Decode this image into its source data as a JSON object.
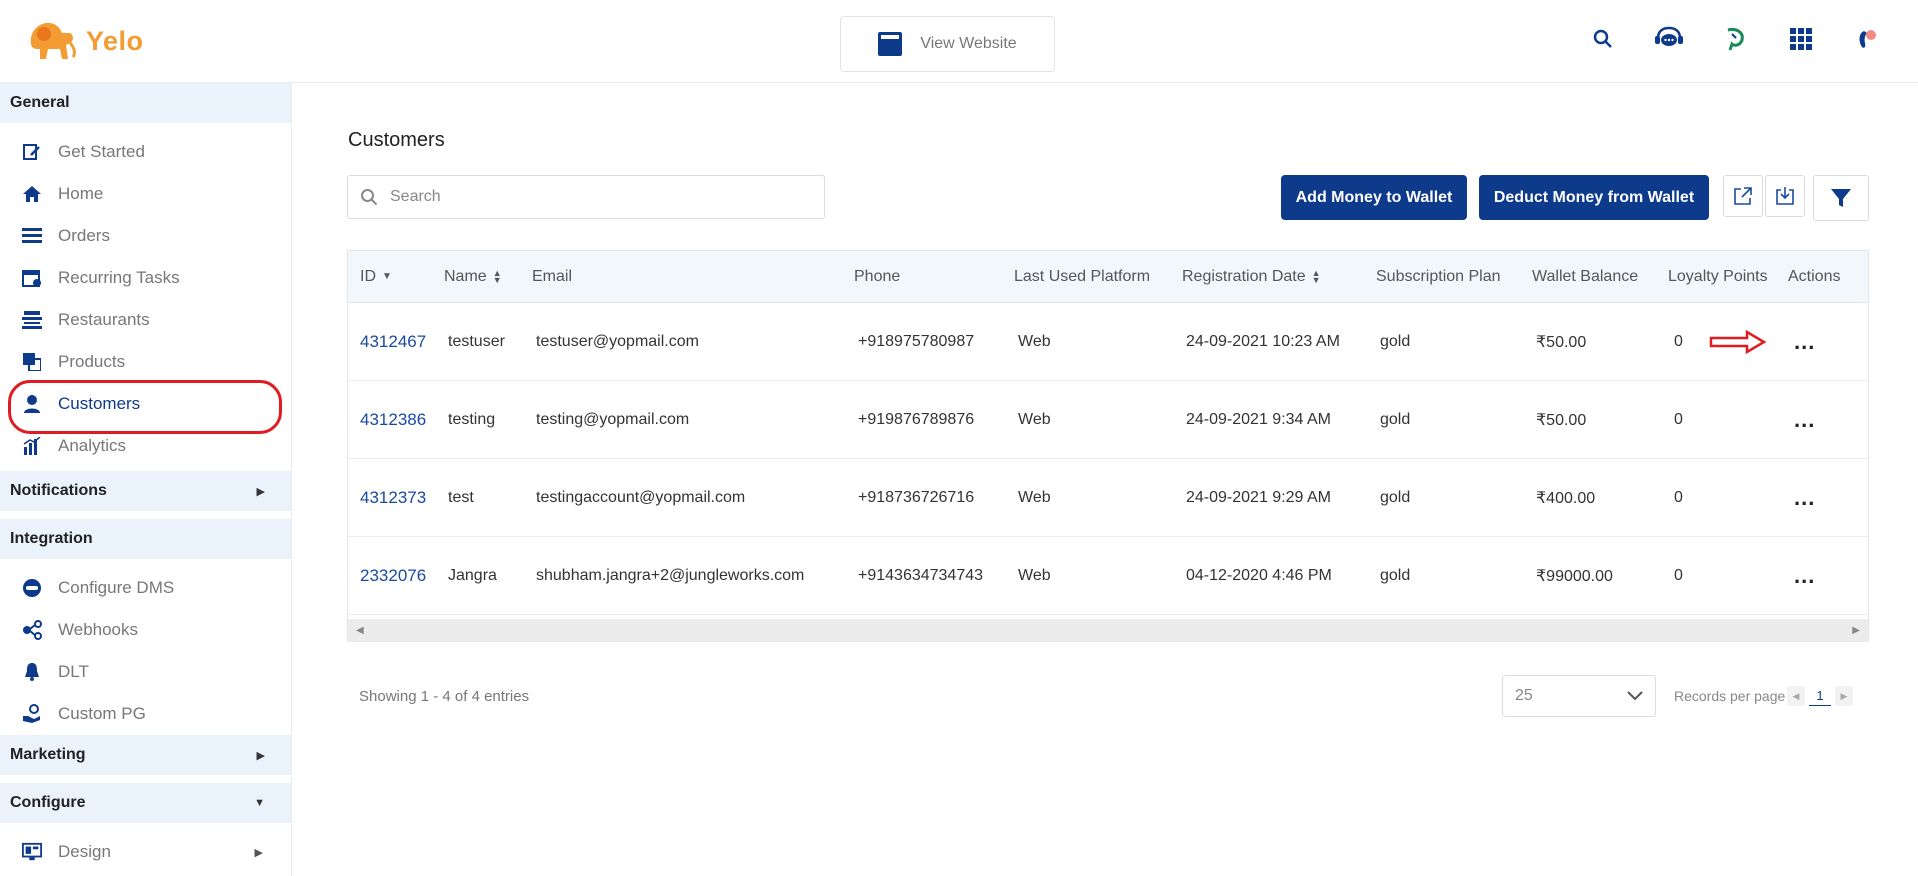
{
  "brand": {
    "name": "Yelo",
    "color": "#f39c34"
  },
  "header": {
    "view_website_label": "View Website",
    "icons": [
      "search-icon",
      "support-chat-icon",
      "leaf-icon",
      "apps-grid-icon",
      "profile-icon"
    ]
  },
  "sidebar": {
    "sections": {
      "general": "General",
      "notifications": "Notifications",
      "integration": "Integration",
      "marketing": "Marketing",
      "configure": "Configure"
    },
    "general_items": [
      {
        "label": "Get Started",
        "icon": "edit-icon"
      },
      {
        "label": "Home",
        "icon": "home-icon"
      },
      {
        "label": "Orders",
        "icon": "orders-icon"
      },
      {
        "label": "Recurring Tasks",
        "icon": "calendar-icon"
      },
      {
        "label": "Restaurants",
        "icon": "store-icon"
      },
      {
        "label": "Products",
        "icon": "products-icon"
      },
      {
        "label": "Customers",
        "icon": "customer-icon"
      },
      {
        "label": "Analytics",
        "icon": "analytics-icon"
      }
    ],
    "integration_items": [
      {
        "label": "Configure DMS",
        "icon": "dms-icon"
      },
      {
        "label": "Webhooks",
        "icon": "webhooks-icon"
      },
      {
        "label": "DLT",
        "icon": "bell-icon"
      },
      {
        "label": "Custom PG",
        "icon": "payment-icon"
      }
    ],
    "configure_items": [
      {
        "label": "Design",
        "icon": "design-icon"
      }
    ]
  },
  "main": {
    "title": "Customers",
    "search_placeholder": "Search",
    "add_money_label": "Add Money to Wallet",
    "deduct_money_label": "Deduct Money from Wallet",
    "table": {
      "headers": [
        "ID",
        "Name",
        "Email",
        "Phone",
        "Last Used Platform",
        "Registration Date",
        "Subscription Plan",
        "Wallet Balance",
        "Loyalty Points",
        "Actions"
      ],
      "rows": [
        {
          "id": "4312467",
          "name": "testuser",
          "email": "testuser@yopmail.com",
          "phone": "+918975780987",
          "platform": "Web",
          "reg_date": "24-09-2021 10:23 AM",
          "plan": "gold",
          "wallet": "₹50.00",
          "loyalty": "0"
        },
        {
          "id": "4312386",
          "name": "testing",
          "email": "testing@yopmail.com",
          "phone": "+919876789876",
          "platform": "Web",
          "reg_date": "24-09-2021 9:34 AM",
          "plan": "gold",
          "wallet": "₹50.00",
          "loyalty": "0"
        },
        {
          "id": "4312373",
          "name": "test",
          "email": "testingaccount@yopmail.com",
          "phone": "+918736726716",
          "platform": "Web",
          "reg_date": "24-09-2021 9:29 AM",
          "plan": "gold",
          "wallet": "₹400.00",
          "loyalty": "0"
        },
        {
          "id": "2332076",
          "name": "Jangra",
          "email": "shubham.jangra+2@jungleworks.com",
          "phone": "+9143634734743",
          "platform": "Web",
          "reg_date": "04-12-2020 4:46 PM",
          "plan": "gold",
          "wallet": "₹99000.00",
          "loyalty": "0"
        }
      ],
      "actions_label": "..."
    },
    "footer": {
      "showing": "Showing 1 - 4 of 4 entries",
      "per_page_value": "25",
      "records_label": "Records per page",
      "current_page": "1"
    }
  },
  "colors": {
    "primary": "#0e3a8c",
    "highlight": "#e01b22",
    "section_bg": "#eaf3fc"
  }
}
